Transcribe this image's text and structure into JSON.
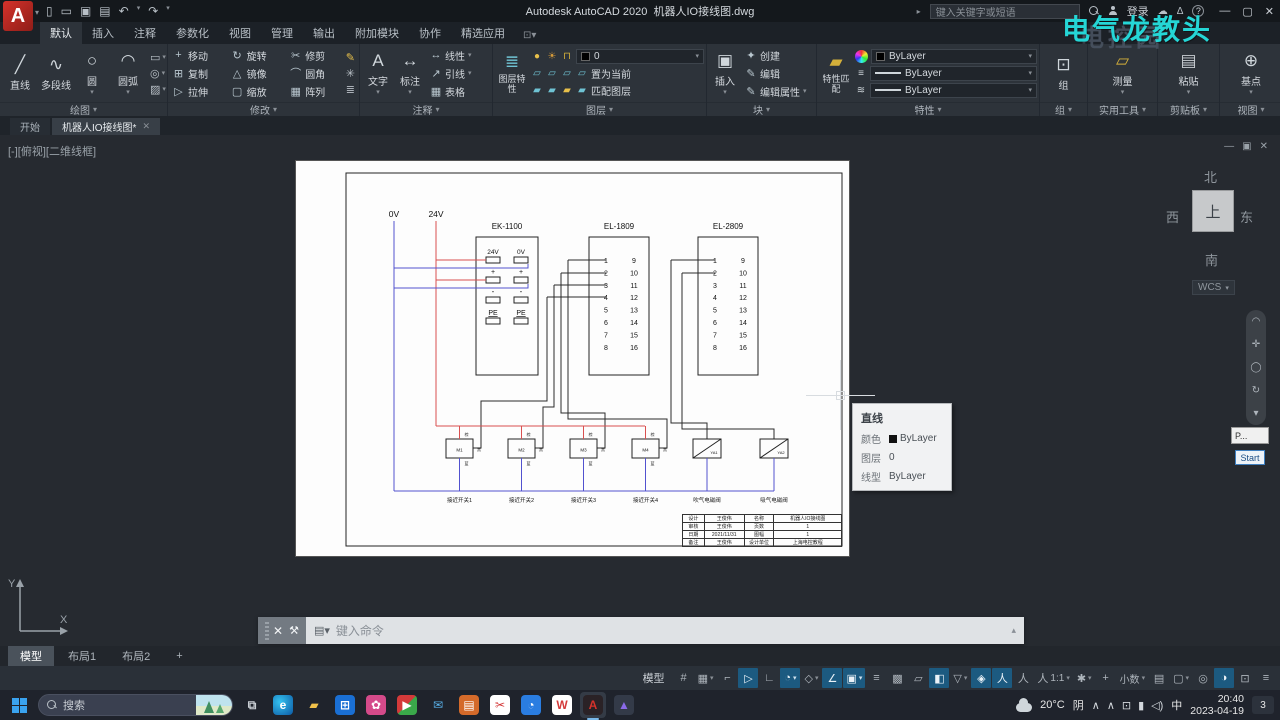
{
  "titlebar": {
    "app_icon": "A",
    "quick_access": [
      "new",
      "open",
      "save",
      "plot",
      "undo",
      "redo"
    ],
    "title": "Autodesk AutoCAD 2020",
    "filename": "机器人IO接线图.dwg",
    "search_placeholder": "键入关键字或短语",
    "signin": "登录",
    "help": "?",
    "window_buttons": [
      "—",
      "▢",
      "✕"
    ]
  },
  "ribbon_tabs": [
    {
      "label": "默认",
      "active": true
    },
    {
      "label": "插入"
    },
    {
      "label": "注释"
    },
    {
      "label": "参数化"
    },
    {
      "label": "视图"
    },
    {
      "label": "管理"
    },
    {
      "label": "输出"
    },
    {
      "label": "附加模块"
    },
    {
      "label": "协作"
    },
    {
      "label": "精选应用"
    }
  ],
  "ribbon": {
    "draw": {
      "label": "绘图",
      "big": [
        [
          "line",
          "直线"
        ],
        [
          "polyline",
          "多段线"
        ],
        [
          "circle",
          "圆"
        ],
        [
          "arc",
          "圆弧"
        ]
      ],
      "small": [
        "rectangle",
        "ellipse",
        "hatch"
      ]
    },
    "modify": {
      "label": "修改",
      "items": [
        [
          "move",
          "移动"
        ],
        [
          "copy",
          "复制"
        ],
        [
          "stretch",
          "拉伸"
        ],
        [
          "rotate",
          "旋转"
        ],
        [
          "mirror",
          "镜像"
        ],
        [
          "scale",
          "缩放"
        ],
        [
          "trim",
          "修剪"
        ],
        [
          "fillet",
          "圆角"
        ],
        [
          "array",
          "阵列"
        ]
      ],
      "side": [
        "erase",
        "explode",
        "offset"
      ]
    },
    "annotate": {
      "label": "注释",
      "big": [
        [
          "text",
          "文字"
        ],
        [
          "dimension",
          "标注"
        ]
      ],
      "rows": [
        [
          "linear",
          "线性",
          true
        ],
        [
          "leader",
          "引线",
          true
        ],
        [
          "table",
          "表格",
          false
        ]
      ]
    },
    "layers": {
      "label": "图层",
      "big_label": "图层特性",
      "layer_value": "0",
      "row2": "置为当前",
      "row3": "匹配图层"
    },
    "block": {
      "label": "块",
      "big_label": "插入",
      "rows": [
        [
          "create",
          "创建",
          false
        ],
        [
          "edit",
          "编辑",
          false
        ],
        [
          "edit-attr",
          "编辑属性",
          true
        ]
      ]
    },
    "properties": {
      "label": "特性",
      "big_label": "特性匹配",
      "selects": [
        "ByLayer",
        "ByLayer",
        "ByLayer"
      ]
    },
    "group": {
      "label": "组",
      "big_label": "组"
    },
    "utilities": {
      "label": "实用工具",
      "big_label": "测量"
    },
    "clipboard": {
      "label": "剪贴板",
      "big_label": "粘贴"
    },
    "view": {
      "label": "视图",
      "big_label": "基点"
    }
  },
  "file_tabs": [
    {
      "label": "开始",
      "active": false
    },
    {
      "label": "机器人IO接线图*",
      "active": true
    }
  ],
  "viewport": {
    "label": "[-][俯视][二维线框]",
    "controls": [
      "—",
      "▣",
      "✕"
    ],
    "viewcube": {
      "n": "北",
      "w": "西",
      "s": "南",
      "e": "东",
      "face": "上",
      "wcs": "WCS"
    },
    "ucs": {
      "x": "X",
      "y": "Y"
    }
  },
  "watermark": {
    "front": "电气龙教头",
    "back": "电控园"
  },
  "floating_panel": {
    "title": "P...",
    "button": "Start"
  },
  "tooltip": {
    "title": "直线",
    "rows": [
      [
        "颜色",
        "ByLayer",
        true
      ],
      [
        "图层",
        "0",
        false
      ],
      [
        "线型",
        "ByLayer",
        false
      ]
    ]
  },
  "command_line": {
    "placeholder": "键入命令"
  },
  "layout_tabs": [
    {
      "label": "模型",
      "active": true
    },
    {
      "label": "布局1"
    },
    {
      "label": "布局2"
    },
    {
      "label": "+"
    }
  ],
  "status_bar": {
    "model_label": "模型",
    "toggles": [
      {
        "name": "grid-display",
        "g": "#"
      },
      {
        "name": "snap-mode",
        "g": "▦",
        "caret": true
      },
      {
        "name": "infer-constraints",
        "g": "⌐"
      },
      {
        "name": "dynamic-input",
        "g": "▷",
        "active": true
      },
      {
        "name": "ortho-mode",
        "g": "∟"
      },
      {
        "name": "polar-tracking",
        "g": "◔",
        "active": true,
        "caret": true
      },
      {
        "name": "isodraft",
        "g": "◇",
        "caret": true
      },
      {
        "name": "osnap-tracking",
        "g": "∠",
        "active": true
      },
      {
        "name": "object-snap",
        "g": "▣",
        "active": true,
        "caret": true
      },
      {
        "name": "lineweight",
        "g": "≡"
      },
      {
        "name": "transparency",
        "g": "▩"
      },
      {
        "name": "selection-cycling",
        "g": "▱"
      },
      {
        "name": "dynamic-ucs",
        "g": "◧",
        "active": true
      },
      {
        "name": "selection-filter",
        "g": "▽",
        "caret": true
      },
      {
        "name": "gizmo",
        "g": "◈",
        "active": true
      },
      {
        "name": "annotation-visibility",
        "g": "人",
        "active": true
      },
      {
        "name": "autoscale",
        "g": "人"
      },
      {
        "name": "annotation-scale",
        "g": "人",
        "text": "1:1",
        "caret": true
      },
      {
        "name": "workspace-switching",
        "g": "✱",
        "caret": true
      },
      {
        "name": "annotation-monitor",
        "g": "+"
      },
      {
        "name": "units",
        "text": "小数",
        "caret": true
      },
      {
        "name": "quick-properties",
        "g": "▤"
      },
      {
        "name": "lock-ui",
        "g": "▢",
        "caret": true
      },
      {
        "name": "isolate-objects",
        "g": "◎"
      },
      {
        "name": "graphics-performance",
        "g": "◑",
        "active": true
      },
      {
        "name": "clean-screen",
        "g": "⊡"
      },
      {
        "name": "customization",
        "g": "≡"
      }
    ]
  },
  "taskbar": {
    "search_placeholder": "搜索",
    "apps": [
      {
        "name": "task-view"
      },
      {
        "name": "edge"
      },
      {
        "name": "file-explorer"
      },
      {
        "name": "store"
      },
      {
        "name": "photos-pink"
      },
      {
        "name": "video-app"
      },
      {
        "name": "mail"
      },
      {
        "name": "office-app"
      },
      {
        "name": "clip-app"
      },
      {
        "name": "browser-app"
      },
      {
        "name": "wps"
      },
      {
        "name": "autocad",
        "active": true
      },
      {
        "name": "gallery-app"
      }
    ],
    "tray": {
      "weather_temp": "20°C",
      "weather_cond": "阴",
      "icons": [
        "∧",
        "∧",
        "⊡",
        "▮",
        "◁)"
      ],
      "ime": "中",
      "time": "20:40",
      "date": "2023-04-19",
      "badge": "3"
    }
  },
  "diagram": {
    "bus_labels": [
      "0V",
      "24V"
    ],
    "ek": {
      "name": "EK-1100",
      "col1": "24V",
      "col2": "0V",
      "plus": "+",
      "minus": "-",
      "pe": "PE"
    },
    "io_blocks": [
      {
        "name": "EL-1809",
        "left": [
          "1",
          "2",
          "3",
          "4",
          "5",
          "6",
          "7",
          "8"
        ],
        "right": [
          "9",
          "10",
          "11",
          "12",
          "13",
          "14",
          "15",
          "16"
        ]
      },
      {
        "name": "EL-2809",
        "left": [
          "1",
          "2",
          "3",
          "4",
          "5",
          "6",
          "7",
          "8"
        ],
        "right": [
          "9",
          "10",
          "11",
          "12",
          "13",
          "14",
          "15",
          "16"
        ]
      }
    ],
    "switches": {
      "labels": [
        "M1",
        "M2",
        "M3",
        "M4"
      ],
      "captions": [
        "接近开关1",
        "接近开关2",
        "接近开关3",
        "接近开关4"
      ],
      "wire_colors": [
        "棕",
        "黑",
        "蓝"
      ]
    },
    "valves": {
      "labels": [
        "YA1",
        "YA2"
      ],
      "captions": [
        "吹气电磁阀",
        "吸气电磁阀"
      ]
    },
    "title_block": {
      "rows": [
        [
          "设计",
          "王俊伟",
          "名称",
          "机器人IO接线图"
        ],
        [
          "审核",
          "王俊伟",
          "页数",
          "1"
        ],
        [
          "日期",
          "2021/11/31",
          "图幅",
          "1"
        ],
        [
          "备注",
          "王俊伟",
          "设计单位",
          "上海电控教程"
        ]
      ]
    },
    "colors": {
      "v24": "#d95050",
      "v0": "#5252cf",
      "signal": "#2a2a2a"
    }
  }
}
